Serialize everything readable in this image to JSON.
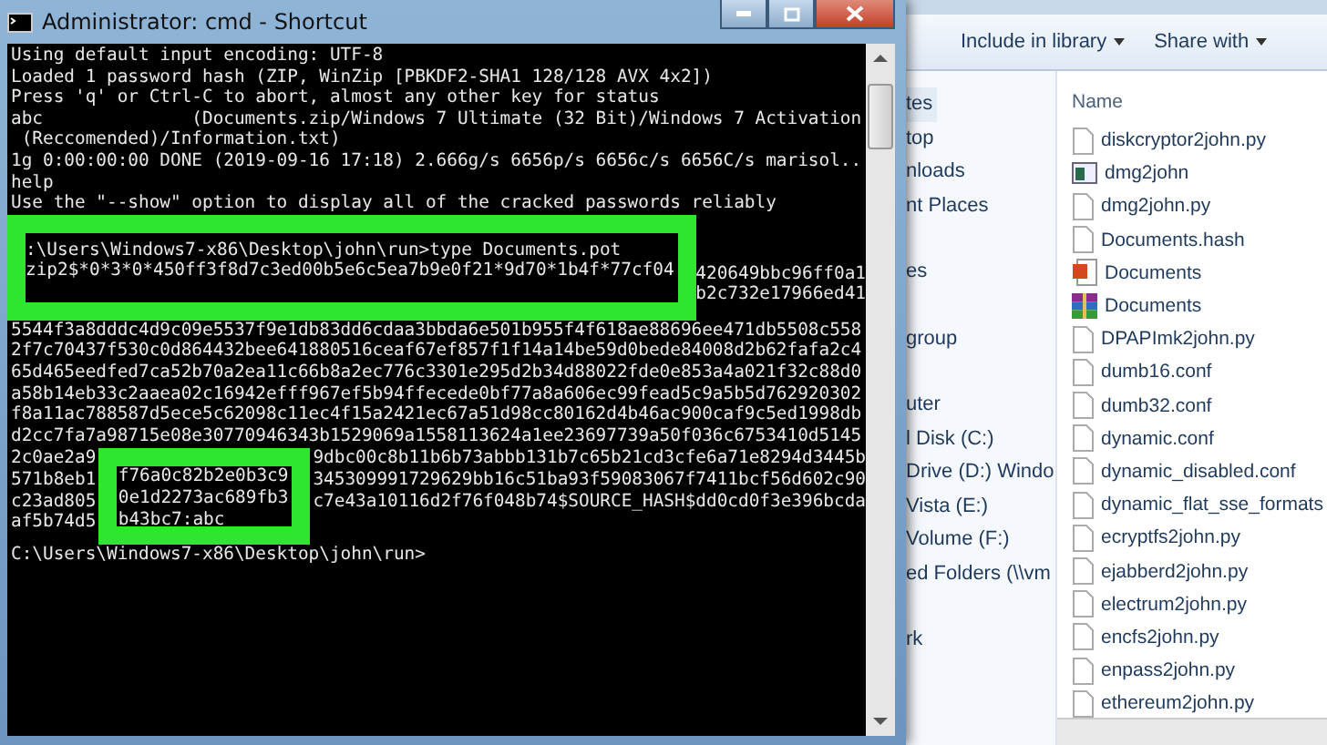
{
  "cmd_window": {
    "title": "Administrator: cmd - Shortcut",
    "lines": [
      "Using default input encoding: UTF-8",
      "Loaded 1 password hash (ZIP, WinZip [PBKDF2-SHA1 128/128 AVX 4x2])",
      "Press 'q' or Ctrl-C to abort, almost any other key for status",
      "abc              (Documents.zip/Windows 7 Ultimate (32 Bit)/Windows 7 Activation",
      " (Reccomended)/Information.txt)",
      "1g 0:00:00:00 DONE (2019-09-16 17:18) 2.666g/s 6656p/s 6656c/s 6656C/s marisol..",
      "help",
      "Use the \"--show\" option to display all of the cracked passwords reliably"
    ],
    "highlight_top": {
      "lines": [
        ":\\Users\\Windows7-x86\\Desktop\\john\\run>type Documents.pot",
        "zip2$*0*3*0*450ff3f8d7c3ed00b5e6c5ea7b9e0f21*9d70*1b4f*77cf04"
      ],
      "right_lines": [
        "420649bbc96ff0a1",
        "b2c732e17966ed41"
      ]
    },
    "hash_lines": [
      "5544f3a8dddc4d9c09e5537f9e1db83dd6cdaa3bbda6e501b955f4f618ae88696ee471db5508c558",
      "2f7c70437f530c0d864432bee641880516ceaf67ef857f1f14a14be59d0bede84008d2b62fafa2c4",
      "65d465eedfed7ca52b70a2ea11c66b8a2ec776c3301e295d2b34d88022fde0e853a4a021f32c88d0",
      "a58b14eb33c2aaea02c16942efff967ef5b94ffecede0bf77a8a606ec99fead5c9a5b5d762920302",
      "f8a11ac788587d5ece5c62098c11ec4f15a2421ec67a51d98cc80162d4b46ac900caf9c5ed1998db",
      "d2cc7fa7a98715e08e30770946343b1529069a1558113624a1ee23697739a50f036c6753410d5145"
    ],
    "highlight_bottom": {
      "left_lines": [
        "2c0ae2a9",
        "571b8eb1",
        "c23ad805",
        "af5b74d5"
      ],
      "lines": [
        "f76a0c82b2e0b3c9",
        "0e1d2273ac689fb3",
        "b43bc7:abc"
      ],
      "right_lines": [
        "9dbc00c8b11b6b73abbb131b7c65b21cd3cfe6a71e8294d3445b",
        "345309991729629bb16c51ba93f59083067f7411bcf56d602c90",
        "c7e43a10116d2f76f048b74$SOURCE_HASH$dd0cd0f3e396bcda"
      ]
    },
    "prompt": "C:\\Users\\Windows7-x86\\Desktop\\john\\run>"
  },
  "explorer": {
    "toolbar": [
      "Include in library",
      "Share with"
    ],
    "nav_items": [
      {
        "label": "tes",
        "selected": true
      },
      {
        "label": "top",
        "selected": false
      },
      {
        "label": "nloads",
        "selected": false
      },
      {
        "label": "nt Places",
        "selected": false
      },
      {
        "label": "es",
        "selected": false
      },
      {
        "label": "group",
        "selected": false
      },
      {
        "label": "uter",
        "selected": false
      },
      {
        "label": "l Disk (C:)",
        "selected": false
      },
      {
        "label": "Drive (D:) Windo",
        "selected": false
      },
      {
        "label": "Vista (E:)",
        "selected": false
      },
      {
        "label": "Volume (F:)",
        "selected": false
      },
      {
        "label": "ed Folders (\\\\vm",
        "selected": false
      },
      {
        "label": "rk",
        "selected": false
      }
    ],
    "column_header": "Name",
    "files": [
      {
        "name": "diskcryptor2john.py",
        "kind": "file"
      },
      {
        "name": "dmg2john",
        "kind": "app"
      },
      {
        "name": "dmg2john.py",
        "kind": "file"
      },
      {
        "name": "Documents.hash",
        "kind": "file"
      },
      {
        "name": "Documents",
        "kind": "office"
      },
      {
        "name": "Documents",
        "kind": "archive"
      },
      {
        "name": "DPAPImk2john.py",
        "kind": "file"
      },
      {
        "name": "dumb16.conf",
        "kind": "file"
      },
      {
        "name": "dumb32.conf",
        "kind": "file"
      },
      {
        "name": "dynamic.conf",
        "kind": "file"
      },
      {
        "name": "dynamic_disabled.conf",
        "kind": "file"
      },
      {
        "name": "dynamic_flat_sse_formats",
        "kind": "file"
      },
      {
        "name": "ecryptfs2john.py",
        "kind": "file"
      },
      {
        "name": "ejabberd2john.py",
        "kind": "file"
      },
      {
        "name": "electrum2john.py",
        "kind": "file"
      },
      {
        "name": "encfs2john.py",
        "kind": "file"
      },
      {
        "name": "enpass2john.py",
        "kind": "file"
      },
      {
        "name": "ethereum2john.py",
        "kind": "file"
      }
    ]
  }
}
